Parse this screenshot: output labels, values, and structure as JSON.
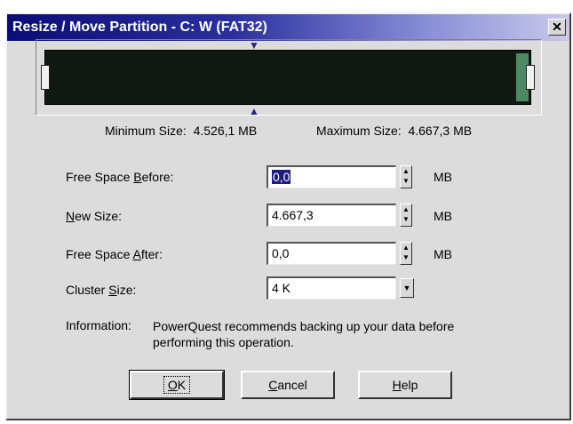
{
  "window": {
    "title": "Resize / Move Partition - C: W (FAT32)",
    "close_glyph": "✕"
  },
  "partition_map": {
    "min_size_label": "Minimum Size:",
    "min_size_value": "4.526,1 MB",
    "max_size_label": "Maximum Size:",
    "max_size_value": "4.667,3 MB",
    "partition_color": "#101a12",
    "free_color": "#4d8a63"
  },
  "fields": {
    "free_before": {
      "label_pre": "Free Space ",
      "label_accel": "B",
      "label_post": "efore:",
      "value": "0,0",
      "unit": "MB"
    },
    "new_size": {
      "label_pre": "",
      "label_accel": "N",
      "label_post": "ew Size:",
      "value": "4.667,3",
      "unit": "MB"
    },
    "free_after": {
      "label_pre": "Free Space ",
      "label_accel": "A",
      "label_post": "fter:",
      "value": "0,0",
      "unit": "MB"
    },
    "cluster_size": {
      "label_pre": "Cluster ",
      "label_accel": "S",
      "label_post": "ize:",
      "value": "4 K"
    }
  },
  "info": {
    "label": "Information:",
    "text": "PowerQuest recommends backing up your data before performing this operation."
  },
  "buttons": {
    "ok": {
      "accel": "O",
      "rest": "K"
    },
    "cancel": {
      "accel": "C",
      "rest": "ancel"
    },
    "help": {
      "accel": "H",
      "rest": "elp"
    }
  },
  "icons": {
    "close": "close-icon",
    "spin_up": "spin-up-icon",
    "spin_down": "spin-down-icon",
    "dropdown": "chevron-down-icon",
    "marker": "triangle-marker-icon"
  }
}
